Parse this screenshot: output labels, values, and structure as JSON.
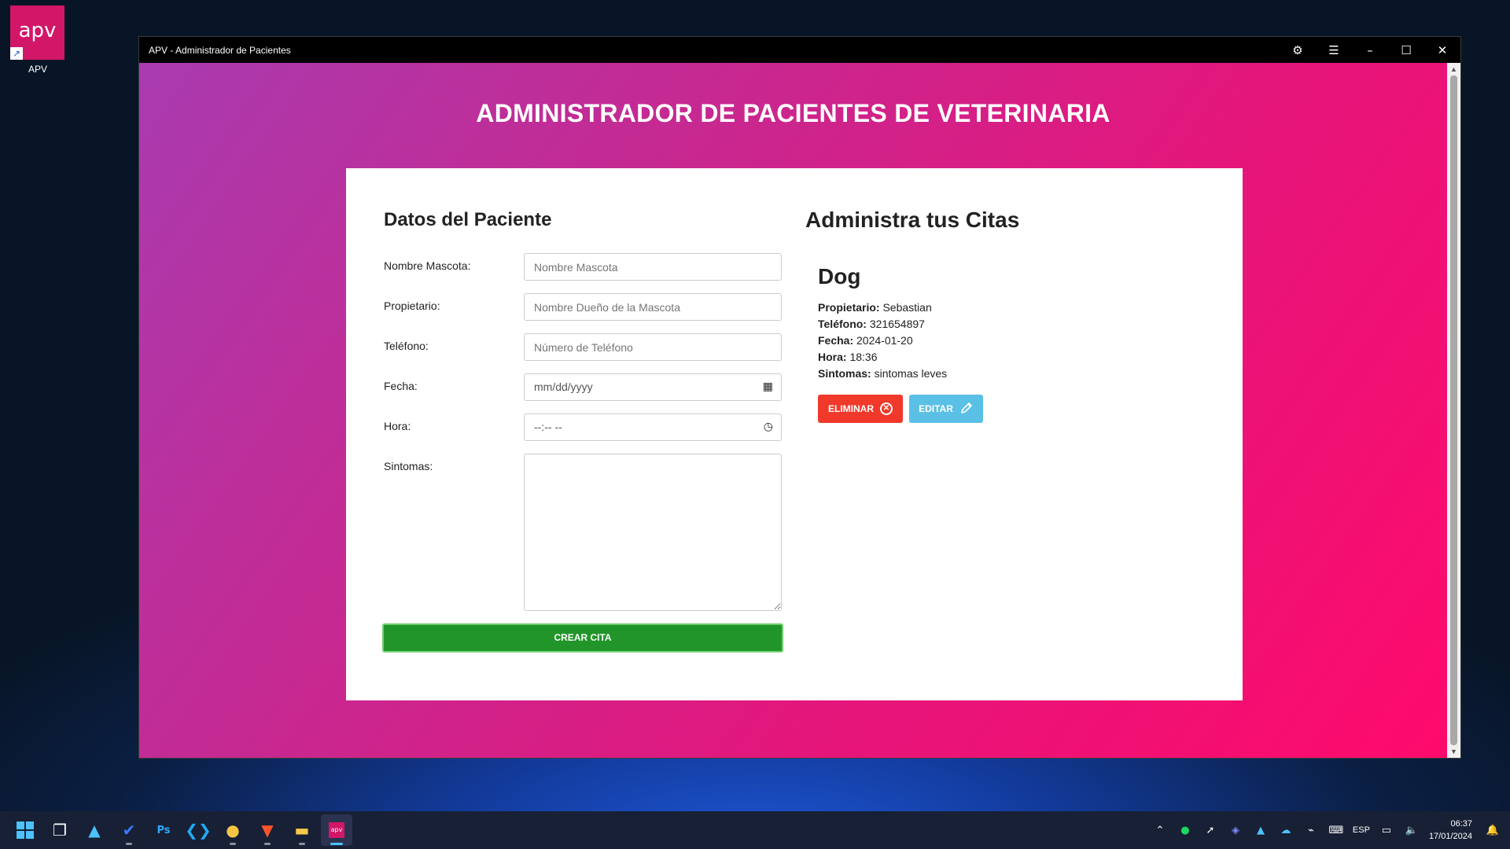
{
  "desktop": {
    "shortcut_tile": "apv",
    "shortcut_label": "APV"
  },
  "window": {
    "title": "APV - Administrador de Pacientes",
    "heading": "ADMINISTRADOR DE PACIENTES DE VETERINARIA"
  },
  "form": {
    "title": "Datos del Paciente",
    "fields": {
      "mascota": {
        "label": "Nombre Mascota:",
        "placeholder": "Nombre Mascota"
      },
      "propietario": {
        "label": "Propietario:",
        "placeholder": "Nombre Dueño de la Mascota"
      },
      "telefono": {
        "label": "Teléfono:",
        "placeholder": "Número de Teléfono"
      },
      "fecha": {
        "label": "Fecha:",
        "value": "mm/dd/yyyy"
      },
      "hora": {
        "label": "Hora:",
        "value": "--:-- --"
      },
      "sintomas": {
        "label": "Sintomas:"
      }
    },
    "submit_label": "CREAR CITA"
  },
  "citas": {
    "title": "Administra tus Citas",
    "items": [
      {
        "mascota": "Dog",
        "propietario_label": "Propietario:",
        "propietario": "Sebastian",
        "telefono_label": "Teléfono:",
        "telefono": "321654897",
        "fecha_label": "Fecha:",
        "fecha": "2024-01-20",
        "hora_label": "Hora:",
        "hora": "18:36",
        "sintomas_label": "Sintomas:",
        "sintomas": "sintomas leves",
        "delete_label": "ELIMINAR",
        "edit_label": "EDITAR"
      }
    ]
  },
  "taskbar": {
    "language": "ESP",
    "time": "06:37",
    "date": "17/01/2024",
    "apps": [
      "start-icon",
      "task-view-icon",
      "app-store-icon",
      "todo-icon",
      "photoshop-icon",
      "vscode-icon",
      "paint-icon",
      "brave-icon",
      "file-explorer-icon",
      "apv-icon"
    ]
  },
  "colors": {
    "gradient_start": "#a93bb0",
    "gradient_end": "#ff0a6c",
    "create_button": "#22952a",
    "delete_button": "#f0392b",
    "edit_button": "#5bc0e6",
    "shortcut_tile": "#d21668"
  }
}
